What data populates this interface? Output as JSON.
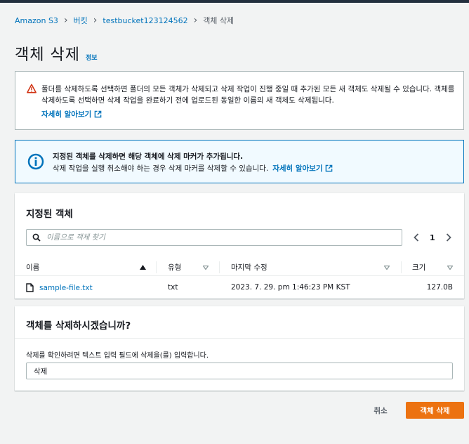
{
  "breadcrumb": {
    "items": [
      "Amazon S3",
      "버킷",
      "testbucket123124562"
    ],
    "current": "객체 삭제"
  },
  "page": {
    "title": "객체 삭제",
    "info_link": "정보"
  },
  "warning": {
    "text": "폴더를 삭제하도록 선택하면 폴더의 모든 객체가 삭제되고 삭제 작업이 진행 중일 때 추가된 모든 새 객체도 삭제될 수 있습니다. 객체를 삭제하도록 선택하면 삭제 작업을 완료하기 전에 업로드된 동일한 이름의 새 객체도 삭제됩니다.",
    "learn_more": "자세히 알아보기"
  },
  "info": {
    "line1": "지정된 객체를 삭제하면 해당 객체에 삭제 마커가 추가됩니다.",
    "line2": "삭제 작업을 실행 취소해야 하는 경우 삭제 마커를 삭제할 수 있습니다.",
    "learn_more": "자세히 알아보기"
  },
  "objects": {
    "heading": "지정된 객체",
    "search_placeholder": "이름으로 객체 찾기",
    "page": "1",
    "columns": [
      "이름",
      "유형",
      "마지막 수정",
      "크기"
    ],
    "rows": [
      {
        "name": "sample-file.txt",
        "type": "txt",
        "modified": "2023. 7. 29. pm 1:46:23 PM KST",
        "size": "127.0B"
      }
    ]
  },
  "confirm": {
    "heading": "객체를 삭제하시겠습니까?",
    "label": "삭제를 확인하려면 텍스트 입력 필드에 삭제을(를) 입력합니다.",
    "value": "삭제"
  },
  "actions": {
    "cancel": "취소",
    "delete": "객체 삭제"
  },
  "colors": {
    "link": "#0073bb",
    "warning_icon": "#d13212",
    "info_border": "#0073bb",
    "primary_button": "#ec7211"
  }
}
